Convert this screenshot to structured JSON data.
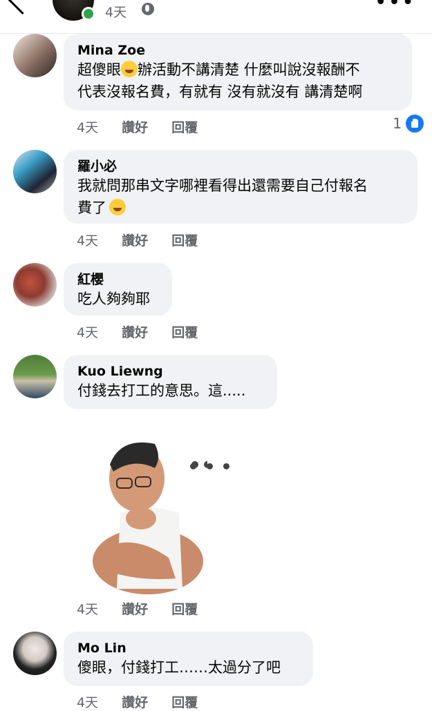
{
  "header": {
    "time": "4天"
  },
  "comments": [
    {
      "author": "Mina Zoe",
      "line1": "超傻眼",
      "line1b": "辦活動不講清楚 什麼叫說沒報酬不",
      "line2": "代表沒報名費，有就有 沒有就沒有 講清楚啊",
      "time": "4天",
      "like": "讚好",
      "reply": "回覆",
      "reaction_count": "1"
    },
    {
      "author": "羅小必",
      "line1": "我就問那串文字哪裡看得出還需要自己付報名",
      "line2": "費了",
      "time": "4天",
      "like": "讚好",
      "reply": "回覆"
    },
    {
      "author": "紅櫻",
      "line1": "吃人夠夠耶",
      "time": "4天",
      "like": "讚好",
      "reply": "回覆"
    },
    {
      "author": "Kuo Liewng",
      "line1": "付錢去打工的意思。這.....",
      "time": "4天",
      "like": "讚好",
      "reply": "回覆"
    },
    {
      "time": "4天",
      "like": "讚好",
      "reply": "回覆"
    },
    {
      "author": "Mo Lin",
      "line1": "傻眼，付錢打工……太過分了吧",
      "time": "4天",
      "like": "讚好",
      "reply": "回覆"
    }
  ],
  "colors": {
    "bubble": "#f0f2f5",
    "meta": "#65676b",
    "like_badge": "#1877f2",
    "online": "#31a24c"
  },
  "icons": [
    "back-chevron-icon",
    "globe-icon",
    "more-icon",
    "like-reaction-icon",
    "rofl-emoji-icon",
    "sweat-smile-emoji-icon"
  ]
}
